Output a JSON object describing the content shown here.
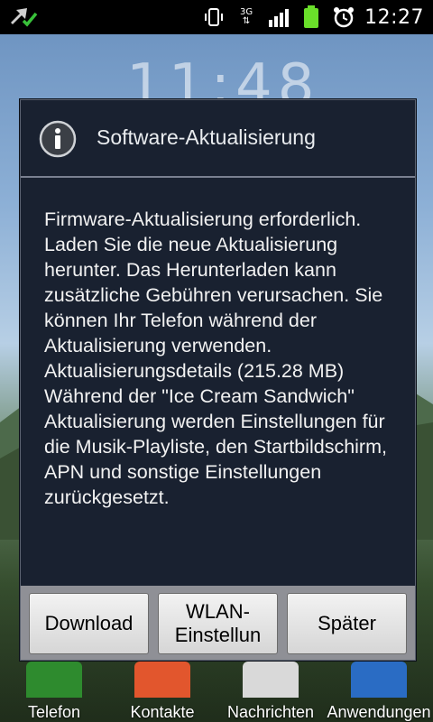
{
  "status_bar": {
    "network": "3G",
    "time": "12:27"
  },
  "home": {
    "clock": "11:48",
    "dock": [
      {
        "label": "Telefon",
        "color": "#2e8b2e"
      },
      {
        "label": "Kontakte",
        "color": "#e2562d"
      },
      {
        "label": "Nachrichten",
        "color": "#d9d9d9"
      },
      {
        "label": "Anwendungen",
        "color": "#2a6cc4"
      }
    ]
  },
  "dialog": {
    "title": "Software-Aktualisierung",
    "message": "Firmware-Aktualisierung erforderlich. Laden Sie die neue Aktualisierung herunter. Das Herunterladen kann zusätzliche Gebühren verursachen. Sie können Ihr Telefon während der Aktualisierung verwenden. Aktualisierungsdetails (215.28 MB) Während der \"Ice Cream Sandwich\" Aktualisierung werden Einstellungen für die Musik-Playliste, den Startbildschirm, APN und sonstige Einstellungen zurückgesetzt.",
    "buttons": {
      "download": "Download",
      "wlan_line1": "WLAN-",
      "wlan_line2": "Einstellun",
      "later": "Später"
    }
  }
}
